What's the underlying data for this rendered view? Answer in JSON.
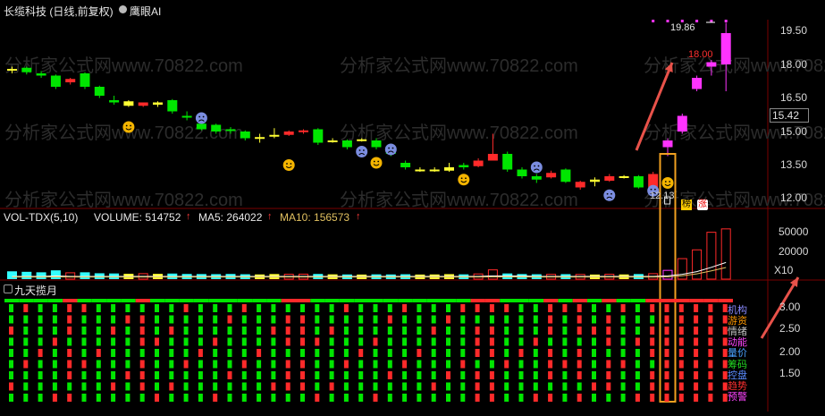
{
  "header": {
    "title": "长缆科技 (日线,前复权)",
    "ai_label": "鹰眼AI",
    "icon": "eye-icon"
  },
  "price_axis": [
    "19.50",
    "18.00",
    "16.50",
    "15.00",
    "13.50",
    "12.00"
  ],
  "current_price": "15.42",
  "annotations": {
    "high": "19.86",
    "mid": "18.00",
    "low": "12.13",
    "bang": "榜",
    "zhang": "涨"
  },
  "watermark": "分析家公式网www.70822.com",
  "volume_bar": {
    "indicator": "VOL-TDX(5,10)",
    "volume_label": "VOLUME: 514752",
    "ma5_label": "MA5: 264022",
    "ma10_label": "MA10: 156573",
    "arrow": "↑"
  },
  "volume_axis": [
    "50000",
    "20000",
    "X10"
  ],
  "indicator_bar": {
    "name": "九天揽月"
  },
  "indicator_axis": [
    "3.00",
    "2.50",
    "2.00",
    "1.50"
  ],
  "indicator_legend": [
    {
      "label": "机构",
      "color": "#8a8aff"
    },
    {
      "label": "游资",
      "color": "#ff9900"
    },
    {
      "label": "情绪",
      "color": "#c0c0c0"
    },
    {
      "label": "动能",
      "color": "#ff44ff"
    },
    {
      "label": "量价",
      "color": "#4aa3ff"
    },
    {
      "label": "筹码",
      "color": "#22dd22"
    },
    {
      "label": "控盘",
      "color": "#5b8cff"
    },
    {
      "label": "趋势",
      "color": "#ff3030"
    },
    {
      "label": "预警",
      "color": "#ff44ff"
    }
  ],
  "colors": {
    "up": "#ff2a2a",
    "down": "#00e600",
    "flat": "#ffff33",
    "surge": "#ff33ff",
    "highlight": "#f0a020",
    "arrow": "#e8524a",
    "volume_down": "#33ffff"
  },
  "chart_data": {
    "type": "candlestick",
    "ylim": [
      11.6,
      20.0
    ],
    "candles": [
      {
        "o": 17.8,
        "h": 17.9,
        "l": 17.6,
        "c": 17.8,
        "t": "flat"
      },
      {
        "o": 17.85,
        "h": 17.9,
        "l": 17.55,
        "c": 17.65,
        "t": "down"
      },
      {
        "o": 17.6,
        "h": 17.7,
        "l": 17.4,
        "c": 17.5,
        "t": "down"
      },
      {
        "o": 17.5,
        "h": 17.55,
        "l": 16.9,
        "c": 17.0,
        "t": "down"
      },
      {
        "o": 17.2,
        "h": 17.4,
        "l": 17.1,
        "c": 17.35,
        "t": "up"
      },
      {
        "o": 17.6,
        "h": 17.65,
        "l": 16.9,
        "c": 17.0,
        "t": "down"
      },
      {
        "o": 17.0,
        "h": 17.05,
        "l": 16.5,
        "c": 16.6,
        "t": "down"
      },
      {
        "o": 16.4,
        "h": 16.6,
        "l": 16.2,
        "c": 16.3,
        "t": "down"
      },
      {
        "o": 16.35,
        "h": 16.4,
        "l": 16.1,
        "c": 16.15,
        "t": "flat"
      },
      {
        "o": 16.15,
        "h": 16.3,
        "l": 16.1,
        "c": 16.3,
        "t": "up"
      },
      {
        "o": 16.3,
        "h": 16.35,
        "l": 16.1,
        "c": 16.2,
        "t": "flat"
      },
      {
        "o": 16.4,
        "h": 16.45,
        "l": 15.8,
        "c": 15.9,
        "t": "down"
      },
      {
        "o": 15.65,
        "h": 15.9,
        "l": 15.5,
        "c": 15.7,
        "t": "down"
      },
      {
        "o": 15.35,
        "h": 15.45,
        "l": 15.05,
        "c": 15.1,
        "t": "down"
      },
      {
        "o": 15.3,
        "h": 15.35,
        "l": 14.9,
        "c": 15.0,
        "t": "down"
      },
      {
        "o": 15.1,
        "h": 15.2,
        "l": 14.9,
        "c": 15.05,
        "t": "down"
      },
      {
        "o": 15.0,
        "h": 15.05,
        "l": 14.6,
        "c": 14.7,
        "t": "down"
      },
      {
        "o": 14.75,
        "h": 14.9,
        "l": 14.5,
        "c": 14.7,
        "t": "flat"
      },
      {
        "o": 14.85,
        "h": 15.15,
        "l": 14.7,
        "c": 14.8,
        "t": "flat"
      },
      {
        "o": 14.85,
        "h": 15.05,
        "l": 14.8,
        "c": 15.0,
        "t": "up"
      },
      {
        "o": 15.0,
        "h": 15.1,
        "l": 14.9,
        "c": 15.05,
        "t": "up"
      },
      {
        "o": 15.1,
        "h": 15.15,
        "l": 14.4,
        "c": 14.5,
        "t": "down"
      },
      {
        "o": 14.6,
        "h": 14.7,
        "l": 14.5,
        "c": 14.6,
        "t": "flat"
      },
      {
        "o": 14.6,
        "h": 14.65,
        "l": 14.2,
        "c": 14.3,
        "t": "down"
      },
      {
        "o": 14.65,
        "h": 14.7,
        "l": 14.55,
        "c": 14.6,
        "t": "flat"
      },
      {
        "o": 14.6,
        "h": 14.7,
        "l": 14.2,
        "c": 14.3,
        "t": "down"
      },
      {
        "o": 14.1,
        "h": 14.2,
        "l": 13.9,
        "c": 14.0,
        "t": "down"
      },
      {
        "o": 13.6,
        "h": 13.7,
        "l": 13.3,
        "c": 13.4,
        "t": "down"
      },
      {
        "o": 13.3,
        "h": 13.4,
        "l": 13.2,
        "c": 13.3,
        "t": "flat"
      },
      {
        "o": 13.3,
        "h": 13.4,
        "l": 13.2,
        "c": 13.3,
        "t": "flat"
      },
      {
        "o": 13.25,
        "h": 13.6,
        "l": 13.2,
        "c": 13.4,
        "t": "flat"
      },
      {
        "o": 13.4,
        "h": 13.6,
        "l": 13.3,
        "c": 13.5,
        "t": "down"
      },
      {
        "o": 13.45,
        "h": 13.8,
        "l": 13.4,
        "c": 13.7,
        "t": "up"
      },
      {
        "o": 13.7,
        "h": 14.9,
        "l": 13.7,
        "c": 14.0,
        "t": "up"
      },
      {
        "o": 14.0,
        "h": 14.1,
        "l": 13.2,
        "c": 13.3,
        "t": "down"
      },
      {
        "o": 13.3,
        "h": 13.4,
        "l": 12.9,
        "c": 13.0,
        "t": "down"
      },
      {
        "o": 13.0,
        "h": 13.1,
        "l": 12.7,
        "c": 12.85,
        "t": "down"
      },
      {
        "o": 12.95,
        "h": 13.25,
        "l": 12.9,
        "c": 13.15,
        "t": "up"
      },
      {
        "o": 13.3,
        "h": 13.35,
        "l": 12.7,
        "c": 12.75,
        "t": "down"
      },
      {
        "o": 12.5,
        "h": 12.8,
        "l": 12.4,
        "c": 12.75,
        "t": "up"
      },
      {
        "o": 12.75,
        "h": 12.95,
        "l": 12.55,
        "c": 12.85,
        "t": "flat"
      },
      {
        "o": 12.8,
        "h": 13.1,
        "l": 12.75,
        "c": 13.0,
        "t": "up"
      },
      {
        "o": 13.0,
        "h": 13.05,
        "l": 12.9,
        "c": 12.95,
        "t": "flat"
      },
      {
        "o": 13.0,
        "h": 13.05,
        "l": 12.45,
        "c": 12.5,
        "t": "down"
      },
      {
        "o": 12.5,
        "h": 13.2,
        "l": 12.5,
        "c": 13.1,
        "t": "up"
      },
      {
        "o": 14.3,
        "h": 14.7,
        "l": 13.9,
        "c": 14.6,
        "t": "surge"
      },
      {
        "o": 15.0,
        "h": 15.8,
        "l": 14.9,
        "c": 15.7,
        "t": "surge"
      },
      {
        "o": 16.9,
        "h": 17.5,
        "l": 16.8,
        "c": 17.4,
        "t": "surge"
      },
      {
        "o": 17.9,
        "h": 18.2,
        "l": 17.5,
        "c": 18.1,
        "t": "surge"
      },
      {
        "o": 18.0,
        "h": 19.86,
        "l": 16.8,
        "c": 19.4,
        "t": "surge"
      }
    ],
    "faces": [
      {
        "i": 8,
        "p": 15.2,
        "m": "happy"
      },
      {
        "i": 13,
        "p": 15.6,
        "m": "sad"
      },
      {
        "i": 19,
        "p": 13.5,
        "m": "happy"
      },
      {
        "i": 24,
        "p": 14.1,
        "m": "sad"
      },
      {
        "i": 25,
        "p": 13.6,
        "m": "happy"
      },
      {
        "i": 26,
        "p": 14.2,
        "m": "sad"
      },
      {
        "i": 31,
        "p": 12.85,
        "m": "happy"
      },
      {
        "i": 36,
        "p": 13.4,
        "m": "sad"
      },
      {
        "i": 41,
        "p": 12.15,
        "m": "sad"
      },
      {
        "i": 44,
        "p": 12.35,
        "m": "sad"
      },
      {
        "i": 45,
        "p": 12.7,
        "m": "happy"
      }
    ],
    "volume": [
      8000,
      7500,
      7000,
      9000,
      6500,
      7000,
      6000,
      5800,
      5500,
      5600,
      5400,
      5700,
      5300,
      5200,
      5100,
      5300,
      5000,
      4800,
      5200,
      5000,
      5100,
      5300,
      4900,
      4800,
      4700,
      4900,
      4800,
      5000,
      4700,
      4800,
      5100,
      4900,
      5300,
      9500,
      5800,
      5200,
      5000,
      4900,
      5100,
      4800,
      4700,
      5000,
      4800,
      5200,
      5600,
      9000,
      21000,
      30000,
      48000,
      51475
    ],
    "volume_colors": [
      "down",
      "down",
      "down",
      "down",
      "up",
      "down",
      "down",
      "down",
      "flat",
      "up",
      "flat",
      "down",
      "down",
      "down",
      "down",
      "down",
      "down",
      "flat",
      "flat",
      "up",
      "up",
      "down",
      "flat",
      "down",
      "flat",
      "down",
      "down",
      "down",
      "flat",
      "flat",
      "flat",
      "down",
      "up",
      "up",
      "down",
      "down",
      "down",
      "up",
      "down",
      "up",
      "flat",
      "up",
      "flat",
      "down",
      "up",
      "surge",
      "up",
      "up",
      "up",
      "up"
    ],
    "ma5_rel": [
      0.05,
      0.05,
      0.05,
      0.06,
      0.05,
      0.05,
      0.05,
      0.05,
      0.05,
      0.05,
      0.05,
      0.05,
      0.05,
      0.05,
      0.05,
      0.05,
      0.05,
      0.05,
      0.05,
      0.05,
      0.05,
      0.05,
      0.05,
      0.05,
      0.05,
      0.05,
      0.05,
      0.05,
      0.05,
      0.05,
      0.05,
      0.05,
      0.05,
      0.06,
      0.06,
      0.06,
      0.05,
      0.05,
      0.05,
      0.05,
      0.05,
      0.05,
      0.05,
      0.05,
      0.05,
      0.06,
      0.09,
      0.14,
      0.22,
      0.31
    ],
    "indicator_rows": 9
  }
}
